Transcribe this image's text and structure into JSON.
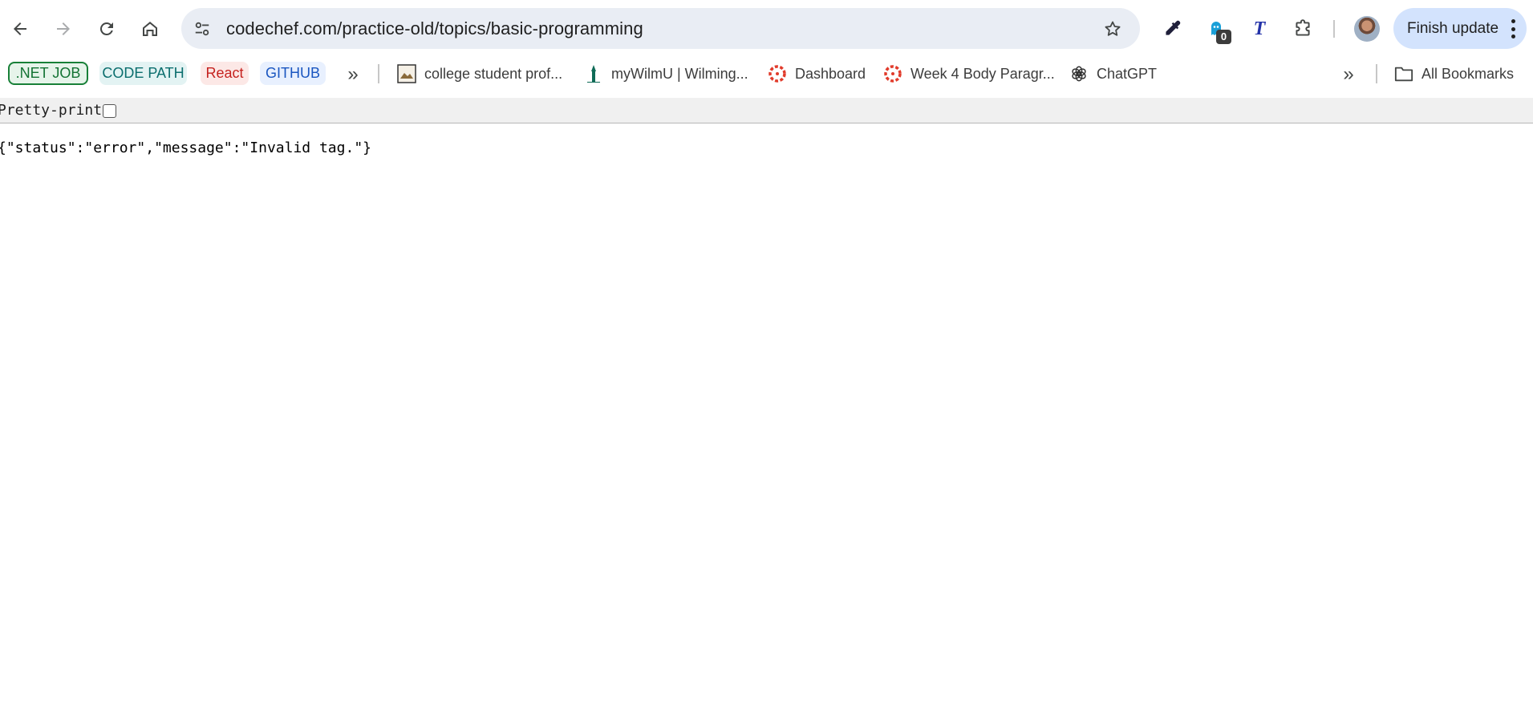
{
  "browser": {
    "url": "codechef.com/practice-old/topics/basic-programming",
    "update_button_label": "Finish update",
    "extension_badge_count": "0",
    "extension_t_letter": "T"
  },
  "bookmarks": {
    "chips": [
      {
        "label": ".NET JOB",
        "color": "#137333"
      },
      {
        "label": "CODE PATH",
        "color": "#0b6e6e"
      },
      {
        "label": "React",
        "color": "#c5221f"
      },
      {
        "label": "GITHUB",
        "color": "#1a56c0"
      }
    ],
    "items": [
      {
        "label": "college student prof...",
        "icon": "bookmark-image-icon"
      },
      {
        "label": "myWilmU | Wilming...",
        "icon": "wilmu-tower-icon"
      },
      {
        "label": "Dashboard",
        "icon": "canvas-logo-icon"
      },
      {
        "label": "Week 4 Body Paragr...",
        "icon": "canvas-logo-icon"
      },
      {
        "label": "ChatGPT",
        "icon": "chatgpt-logo-icon"
      }
    ],
    "all_bookmarks_label": "All Bookmarks"
  },
  "viewer": {
    "pretty_print_label": "Pretty-print",
    "pretty_print_checked": false,
    "json_text": "{\"status\":\"error\",\"message\":\"Invalid tag.\"}"
  }
}
